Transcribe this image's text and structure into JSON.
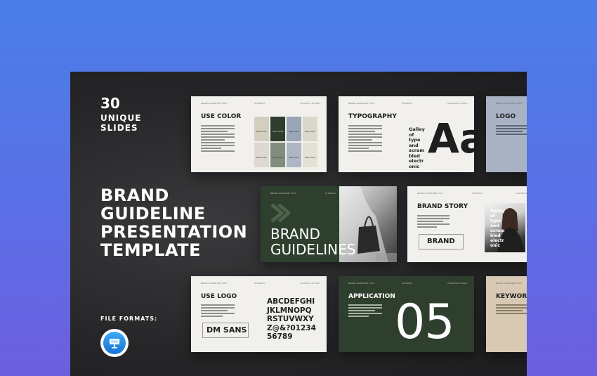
{
  "hero": {
    "count": "30",
    "unique_line1": "UNIQUE",
    "unique_line2": "SLIDES",
    "headline": [
      "BRAND",
      "GUIDELINE",
      "PRESENTATION",
      "TEMPLATE"
    ],
    "file_formats_label": "FILE FORMATS:",
    "format_icon": "keynote-icon"
  },
  "slides": {
    "use_color": {
      "title": "USE COLOR",
      "swatches": [
        {
          "color": "#d2cfbf",
          "label": "Pale Coke"
        },
        {
          "color": "#2f3d2f",
          "label": "Dark Coke"
        },
        {
          "color": "#9aa5b8",
          "label": "Pale Coke"
        },
        {
          "color": "#dad7cb",
          "label": "Pale Coke"
        },
        {
          "color": "#dcdad0",
          "label": "Pale Coke"
        },
        {
          "color": "#808d7d",
          "label": "Pale Coke"
        },
        {
          "color": "#aeb6c4",
          "label": "Pale Coke"
        },
        {
          "color": "#e3e0d6",
          "label": "Pale Coke"
        }
      ]
    },
    "typography": {
      "title": "TYPOGRAPHY",
      "galley": [
        "Galley",
        "of",
        "type",
        "and",
        "scram",
        "bled",
        "electr",
        "onic"
      ],
      "big_text": "Aa"
    },
    "logo": {
      "title": "LOGO"
    },
    "brand_guidelines": {
      "line1": "BRAND",
      "line2": "GUIDELINES"
    },
    "brand_story": {
      "title": "BRAND STORY",
      "logo_text": "BRAND",
      "galley": [
        "Galley",
        "of",
        "type",
        "and",
        "scram",
        "bled",
        "electr",
        "onic"
      ]
    },
    "use_logo": {
      "title": "USE LOGO",
      "logo_text": "DM SANS",
      "alphabet": [
        "ABCDEFGHI",
        "JKLMNOPQ",
        "RSTUVWXY",
        "Z@&?01234",
        "56789"
      ]
    },
    "application": {
      "title": "APPLICATION",
      "number": "05"
    },
    "keyword": {
      "title": "KEYWORD"
    }
  },
  "colors": {
    "background_top": "#4a7ee8",
    "background_bottom": "#6c5ee0",
    "panel": "#262628",
    "slide_green": "#2e3f2e",
    "slide_light": "#f1f0ec",
    "slide_grey_blue": "#a9b2c3",
    "slide_beige": "#d7c9b4"
  }
}
